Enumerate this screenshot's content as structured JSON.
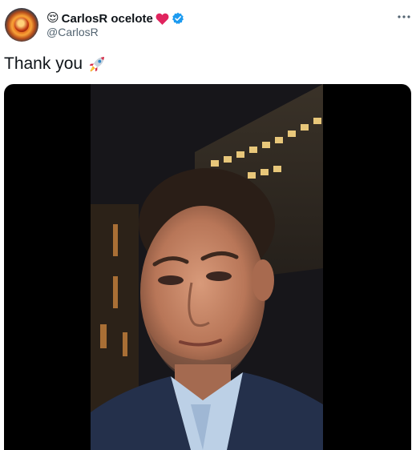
{
  "tweet": {
    "author": {
      "display_name": "CarlosR ocelote",
      "handle": "@CarlosR",
      "name_emoji_prefix": "😌",
      "verified": true,
      "heart_color": "#e0245e",
      "verified_color": "#1d9bf0"
    },
    "text": "Thank you",
    "text_emoji": "rocket",
    "more_icon": "more-horizontal-icon",
    "media": {
      "type": "video"
    }
  }
}
